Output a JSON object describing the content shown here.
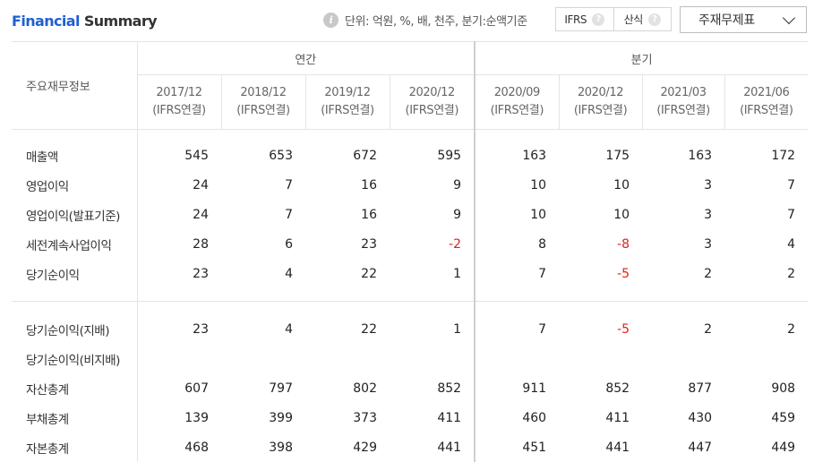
{
  "header": {
    "title_accent": "Financial",
    "title_rest": " Summary",
    "unit_text": "단위: 억원, %, 배, 천주, 분기:순액기준",
    "seg_ifrs": "IFRS",
    "seg_formula": "산식",
    "select_label": "주재무제표"
  },
  "table": {
    "item_header": "주요재무정보",
    "annual_header": "연간",
    "quarter_header": "분기",
    "periods": [
      {
        "date": "2017/12",
        "basis": "(IFRS연결)"
      },
      {
        "date": "2018/12",
        "basis": "(IFRS연결)"
      },
      {
        "date": "2019/12",
        "basis": "(IFRS연결)"
      },
      {
        "date": "2020/12",
        "basis": "(IFRS연결)"
      },
      {
        "date": "2020/09",
        "basis": "(IFRS연결)"
      },
      {
        "date": "2020/12",
        "basis": "(IFRS연결)"
      },
      {
        "date": "2021/03",
        "basis": "(IFRS연결)"
      },
      {
        "date": "2021/06",
        "basis": "(IFRS연결)"
      }
    ],
    "group1": [
      {
        "name": "매출액",
        "values": [
          "545",
          "653",
          "672",
          "595",
          "163",
          "175",
          "163",
          "172"
        ]
      },
      {
        "name": "영업이익",
        "values": [
          "24",
          "7",
          "16",
          "9",
          "10",
          "10",
          "3",
          "7"
        ]
      },
      {
        "name": "영업이익(발표기준)",
        "values": [
          "24",
          "7",
          "16",
          "9",
          "10",
          "10",
          "3",
          "7"
        ]
      },
      {
        "name": "세전계속사업이익",
        "values": [
          "28",
          "6",
          "23",
          "-2",
          "8",
          "-8",
          "3",
          "4"
        ]
      },
      {
        "name": "당기순이익",
        "values": [
          "23",
          "4",
          "22",
          "1",
          "7",
          "-5",
          "2",
          "2"
        ]
      }
    ],
    "group2": [
      {
        "name": "당기순이익(지배)",
        "values": [
          "23",
          "4",
          "22",
          "1",
          "7",
          "-5",
          "2",
          "2"
        ]
      },
      {
        "name": "당기순이익(비지배)",
        "values": [
          "",
          "",
          "",
          "",
          "",
          "",
          "",
          ""
        ]
      },
      {
        "name": "자산총계",
        "values": [
          "607",
          "797",
          "802",
          "852",
          "911",
          "852",
          "877",
          "908"
        ]
      },
      {
        "name": "부채총계",
        "values": [
          "139",
          "399",
          "373",
          "411",
          "460",
          "411",
          "430",
          "459"
        ]
      },
      {
        "name": "자본총계",
        "values": [
          "468",
          "398",
          "429",
          "441",
          "451",
          "441",
          "447",
          "449"
        ]
      }
    ]
  }
}
